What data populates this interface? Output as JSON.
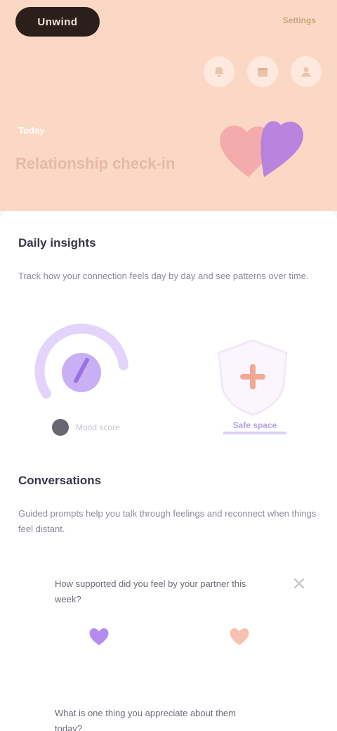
{
  "header": {
    "logo": "Unwind",
    "link": "Settings",
    "kicker": "Today",
    "title": "Relationship check-in",
    "icons": [
      "bell-icon",
      "calendar-icon",
      "profile-icon"
    ]
  },
  "section_one": {
    "title": "Daily insights",
    "body": "Track how your connection feels day by day and see patterns over time."
  },
  "stats": {
    "left_label": "Mood score",
    "right_label": "Safe space"
  },
  "section_two": {
    "title": "Conversations",
    "body": "Guided prompts help you talk through feelings and reconnect when things feel distant."
  },
  "cards": [
    {
      "question": "How supported did you feel by your partner this week?"
    },
    {
      "question": "What is one thing you appreciate about them today?"
    }
  ],
  "colors": {
    "header_bg": "#fbd8c5",
    "accent_purple": "#b48cf0",
    "accent_coral": "#f4a392"
  }
}
